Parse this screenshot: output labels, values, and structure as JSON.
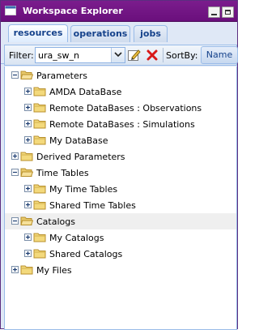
{
  "window": {
    "title": "Workspace Explorer"
  },
  "tabs": [
    {
      "label": "resources",
      "active": true
    },
    {
      "label": "operations",
      "active": false
    },
    {
      "label": "jobs",
      "active": false
    }
  ],
  "toolbar": {
    "filter_label": "Filter:",
    "filter_value": "ura_sw_n",
    "sortby_label": "SortBy:",
    "sort_button": "Name"
  },
  "tree": [
    {
      "label": "Parameters",
      "level": 0,
      "expanded": true
    },
    {
      "label": "AMDA DataBase",
      "level": 1,
      "expanded": false
    },
    {
      "label": "Remote DataBases : Observations",
      "level": 1,
      "expanded": false
    },
    {
      "label": "Remote DataBases : Simulations",
      "level": 1,
      "expanded": false
    },
    {
      "label": "My DataBase",
      "level": 1,
      "expanded": false
    },
    {
      "label": "Derived Parameters",
      "level": 0,
      "expanded": false
    },
    {
      "label": "Time Tables",
      "level": 0,
      "expanded": true
    },
    {
      "label": "My Time Tables",
      "level": 1,
      "expanded": false
    },
    {
      "label": "Shared Time Tables",
      "level": 1,
      "expanded": false
    },
    {
      "label": "Catalogs",
      "level": 0,
      "expanded": true,
      "selected": true
    },
    {
      "label": "My Catalogs",
      "level": 1,
      "expanded": false
    },
    {
      "label": "Shared Catalogs",
      "level": 1,
      "expanded": false
    },
    {
      "label": "My Files",
      "level": 0,
      "expanded": false
    }
  ],
  "colors": {
    "titlebar": "#6a0f7c",
    "tab_text": "#15428b",
    "panel_bg": "#dfe8f6"
  }
}
